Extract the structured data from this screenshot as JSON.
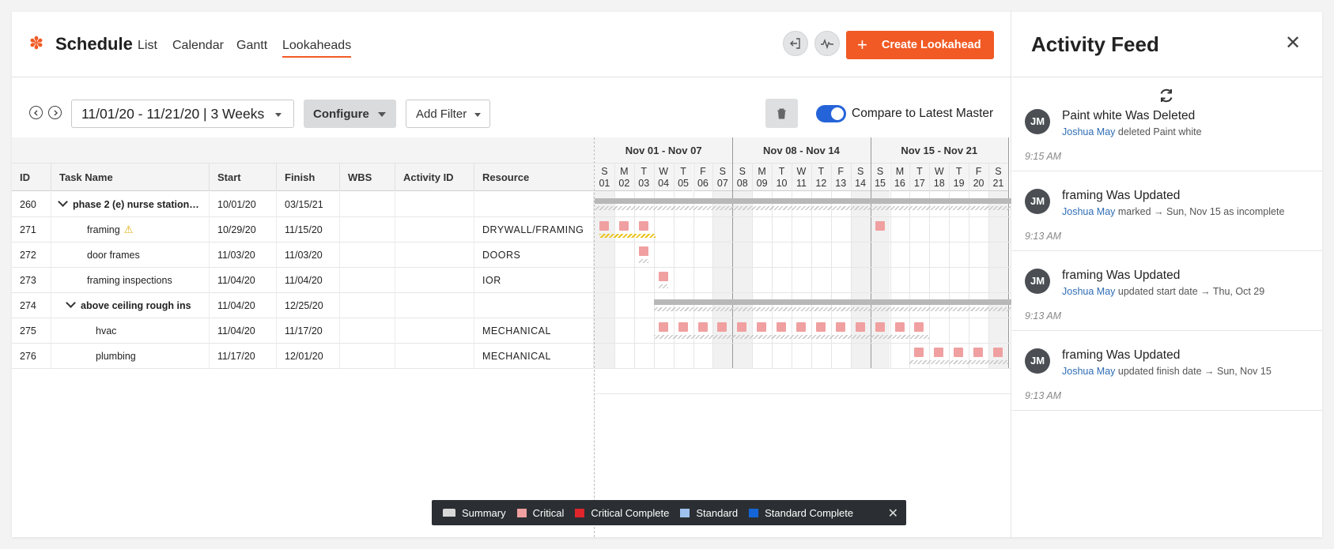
{
  "app": {
    "title": "Schedule",
    "tabs": [
      "List",
      "Calendar",
      "Gantt",
      "Lookaheads"
    ],
    "active_tab": "Lookaheads",
    "create_button": "Create Lookahead",
    "accent_color": "#f15a24"
  },
  "toolbar": {
    "date_range": "11/01/20 - 11/21/20 | 3 Weeks",
    "configure": "Configure",
    "add_filter": "Add Filter",
    "compare_label": "Compare to Latest Master",
    "compare_enabled": true
  },
  "table": {
    "columns": [
      "ID",
      "Task Name",
      "Start",
      "Finish",
      "WBS",
      "Activity ID",
      "Resource"
    ],
    "rows": [
      {
        "id": "260",
        "name": "phase 2 (e) nurse station…",
        "start": "10/01/20",
        "finish": "03/15/21",
        "wbs": "",
        "activity_id": "",
        "resource": "",
        "level": 0,
        "summary": true
      },
      {
        "id": "271",
        "name": "framing",
        "start": "10/29/20",
        "finish": "11/15/20",
        "wbs": "",
        "activity_id": "",
        "resource": "DRYWALL/FRAMING",
        "level": 1,
        "summary": false,
        "warning": true
      },
      {
        "id": "272",
        "name": "door frames",
        "start": "11/03/20",
        "finish": "11/03/20",
        "wbs": "",
        "activity_id": "",
        "resource": "DOORS",
        "level": 1,
        "summary": false
      },
      {
        "id": "273",
        "name": "framing inspections",
        "start": "11/04/20",
        "finish": "11/04/20",
        "wbs": "",
        "activity_id": "",
        "resource": "IOR",
        "level": 1,
        "summary": false
      },
      {
        "id": "274",
        "name": "above ceiling rough ins",
        "start": "11/04/20",
        "finish": "12/25/20",
        "wbs": "",
        "activity_id": "",
        "resource": "",
        "level": 1,
        "summary": true
      },
      {
        "id": "275",
        "name": "hvac",
        "start": "11/04/20",
        "finish": "11/17/20",
        "wbs": "",
        "activity_id": "",
        "resource": "MECHANICAL",
        "level": 2,
        "summary": false
      },
      {
        "id": "276",
        "name": "plumbing",
        "start": "11/17/20",
        "finish": "12/01/20",
        "wbs": "",
        "activity_id": "",
        "resource": "MECHANICAL",
        "level": 2,
        "summary": false
      }
    ]
  },
  "gantt": {
    "weeks": [
      "Nov 01 - Nov 07",
      "Nov 08 - Nov 14",
      "Nov 15 - Nov 21"
    ],
    "day_letters": [
      "S",
      "M",
      "T",
      "W",
      "T",
      "F",
      "S",
      "S",
      "M",
      "T",
      "W",
      "T",
      "F",
      "S",
      "S",
      "M",
      "T",
      "W",
      "T",
      "F",
      "S"
    ],
    "day_numbers": [
      "01",
      "02",
      "03",
      "04",
      "05",
      "06",
      "07",
      "08",
      "09",
      "10",
      "11",
      "12",
      "13",
      "14",
      "15",
      "16",
      "17",
      "18",
      "19",
      "20",
      "21"
    ]
  },
  "legend": {
    "items": [
      {
        "label": "Summary",
        "color": "#d9d9d9"
      },
      {
        "label": "Critical",
        "color": "#f0a0a0"
      },
      {
        "label": "Critical Complete",
        "color": "#e0252c"
      },
      {
        "label": "Standard",
        "color": "#9fc3f0"
      },
      {
        "label": "Standard Complete",
        "color": "#1565d8"
      }
    ]
  },
  "feed": {
    "title": "Activity Feed",
    "items": [
      {
        "initials": "JM",
        "title": "Paint white Was Deleted",
        "user": "Joshua May",
        "text": "deleted Paint white",
        "time": "9:15 AM"
      },
      {
        "initials": "JM",
        "title": "framing Was Updated",
        "user": "Joshua May",
        "text": "marked → Sun, Nov 15 as incomplete",
        "time": "9:13 AM"
      },
      {
        "initials": "JM",
        "title": "framing Was Updated",
        "user": "Joshua May",
        "text": "updated start date → Thu, Oct 29",
        "time": "9:13 AM"
      },
      {
        "initials": "JM",
        "title": "framing Was Updated",
        "user": "Joshua May",
        "text": "updated finish date → Sun, Nov 15",
        "time": "9:13 AM"
      }
    ]
  }
}
